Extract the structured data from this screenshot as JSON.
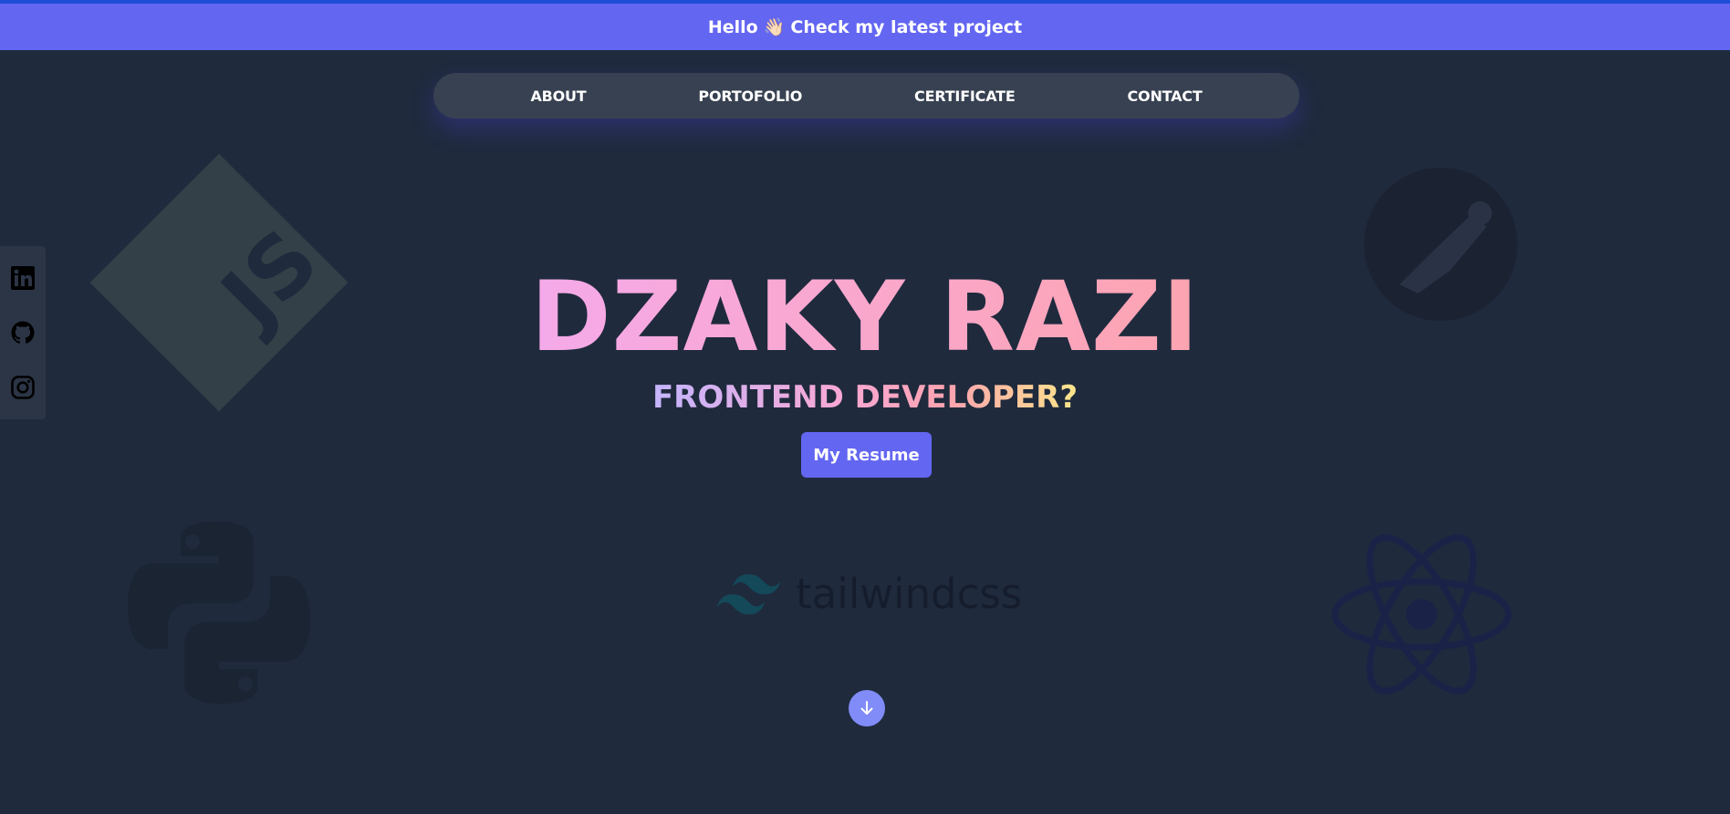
{
  "banner": {
    "greeting": "Hello",
    "wave": "👋🏻",
    "message": "Check my latest project"
  },
  "nav": {
    "items": [
      {
        "label": "ABOUT"
      },
      {
        "label": "PORTOFOLIO"
      },
      {
        "label": "CERTIFICATE"
      },
      {
        "label": "CONTACT"
      }
    ]
  },
  "social": {
    "icons": [
      "linkedin-icon",
      "github-icon",
      "instagram-icon"
    ]
  },
  "hero": {
    "name": "DZAKY RAZI",
    "role": "FRONTEND DEVELOPER?",
    "resume_label": "My Resume"
  },
  "background_logos": {
    "js_text": "JS",
    "tailwind_text": "tailwindcss"
  },
  "colors": {
    "background": "#1f2a3d",
    "banner": "#6366f1",
    "navbar": "#374151",
    "accent": "#818cf8"
  }
}
